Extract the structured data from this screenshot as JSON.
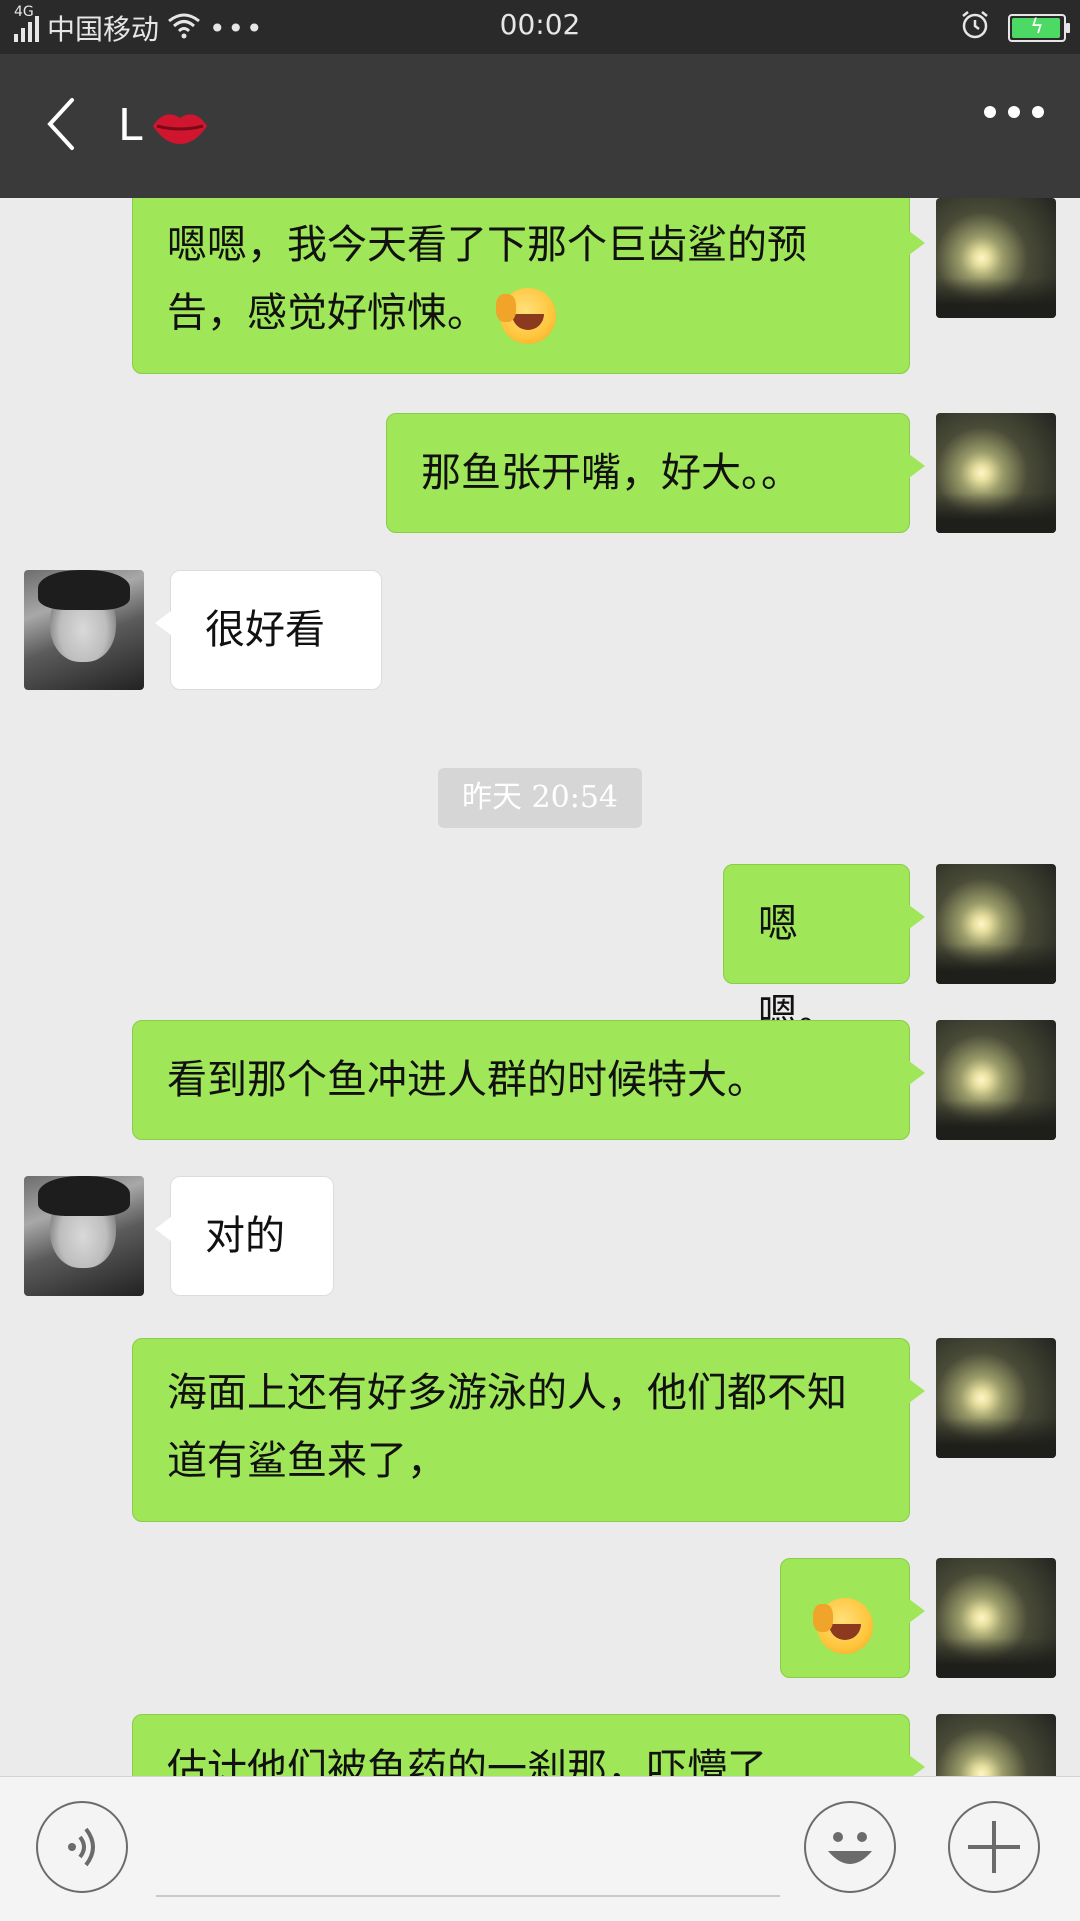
{
  "status_bar": {
    "network": "4G",
    "carrier": "中国移动",
    "time": "00:02"
  },
  "header": {
    "title": "L"
  },
  "messages": [
    {
      "from": "me",
      "text": "嗯嗯，我今天看了下那个巨齿鲨的预告，感觉好惊悚。"
    },
    {
      "from": "me",
      "text": "那鱼张开嘴，好大。。"
    },
    {
      "from": "them",
      "text": "很好看"
    },
    {
      "from": "me",
      "text": "嗯嗯。"
    },
    {
      "from": "me",
      "text": "看到那个鱼冲进人群的时候特大。"
    },
    {
      "from": "them",
      "text": "对的"
    },
    {
      "from": "me",
      "text": "海面上还有好多游泳的人，他们都不知道有鲨鱼来了，"
    },
    {
      "from": "me",
      "text": ""
    },
    {
      "from": "me",
      "text": "估计他们被鱼药的一刹那，吓懵了"
    }
  ],
  "timestamp": "昨天 20:54",
  "colors": {
    "status_bg": "#2a2a2a",
    "header_bg": "#3a3a3a",
    "chat_bg": "#ebebeb",
    "my_bubble": "#9fe658",
    "their_bubble": "#ffffff",
    "battery": "#4cd964"
  },
  "icons": {
    "back": "chevron-left-icon",
    "more": "more-dots-icon",
    "voice": "voice-icon",
    "emoji": "emoji-icon",
    "plus": "plus-icon"
  }
}
